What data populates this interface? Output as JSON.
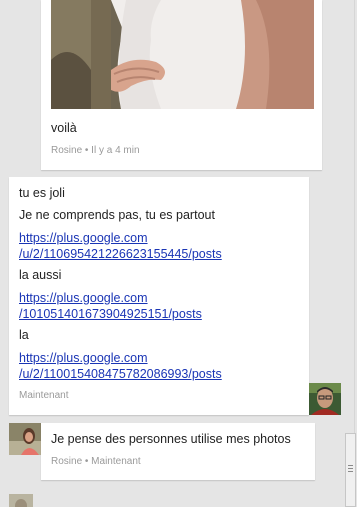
{
  "conversation": {
    "photo_message": {
      "caption": "voilà",
      "meta": "Rosine • Il y a 4 min"
    },
    "my_message": {
      "lines": [
        "tu es joli",
        "Je ne comprends pas, tu es partout"
      ],
      "link1_line1": "https://plus.google.com",
      "link1_line2": "/u/2/110695421226623155445/posts",
      "text_la_aussi": "la aussi",
      "link2_line1": "https://plus.google.com",
      "link2_line2": "/101051401673904925151/posts",
      "text_la": "la",
      "link3_line1": "https://plus.google.com",
      "link3_line2": "/u/2/110015408475782086993/posts",
      "meta": "Maintenant"
    },
    "rosine_message": {
      "text": "Je pense des personnes utilise mes photos",
      "meta": "Rosine • Maintenant"
    }
  },
  "colors": {
    "background": "#e5e5e5",
    "bubble": "#ffffff",
    "link": "#1a35b5",
    "meta": "#9a9a9a"
  }
}
